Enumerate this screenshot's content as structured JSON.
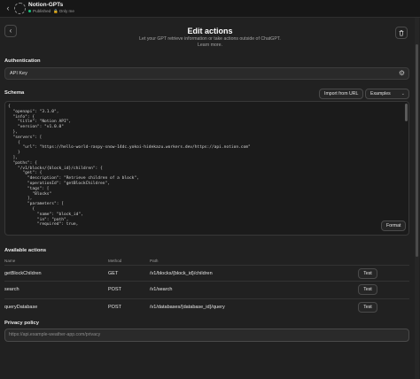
{
  "topbar": {
    "gpt_name": "Notion-GPTs",
    "status_published": "Published",
    "status_visibility": "Only me",
    "back_icon": "chevron-left-icon",
    "lock_icon": "lock-icon"
  },
  "header": {
    "title": "Edit actions",
    "subtitle": "Let your GPT retrieve information or take actions outside of ChatGPT.",
    "learn_more": "Learn more."
  },
  "authentication": {
    "label": "Authentication",
    "value": "API Key"
  },
  "schema": {
    "label": "Schema",
    "import_button": "Import from URL",
    "examples_select": "Examples",
    "format_button": "Format",
    "code": "{\n  \"openapi\": \"3.1.0\",\n  \"info\": {\n    \"title\": \"Notion API\",\n    \"version\": \"v1.0.0\"\n  },\n  \"servers\": [\n    {\n      \"url\": \"https://hello-world-raspy-snow-14dc.yokoi-hidekazu.workers.dev/https://api.notion.com\"\n    }\n  ],\n  \"paths\": {\n    \"/v1/blocks/{block_id}/children\": {\n      \"get\": {\n        \"description\": \"Retrieve children of a block\",\n        \"operationId\": \"getBlockChildren\",\n        \"tags\": [\n          \"Blocks\"\n        ],\n        \"parameters\": [\n          {\n            \"name\": \"block_id\",\n            \"in\": \"path\",\n            \"required\": true,"
  },
  "actions": {
    "label": "Available actions",
    "columns": [
      "Name",
      "Method",
      "Path"
    ],
    "rows": [
      {
        "name": "getBlockChildren",
        "method": "GET",
        "path": "/v1/blocks/{block_id}/children",
        "test": "Test"
      },
      {
        "name": "search",
        "method": "POST",
        "path": "/v1/search",
        "test": "Test"
      },
      {
        "name": "queryDatabase",
        "method": "POST",
        "path": "/v1/databases/{database_id}/query",
        "test": "Test"
      }
    ]
  },
  "privacy": {
    "label": "Privacy policy",
    "placeholder": "https://api.example-weather-app.com/privacy"
  },
  "colors": {
    "background": "#212121",
    "published_dot": "#19c37d"
  }
}
